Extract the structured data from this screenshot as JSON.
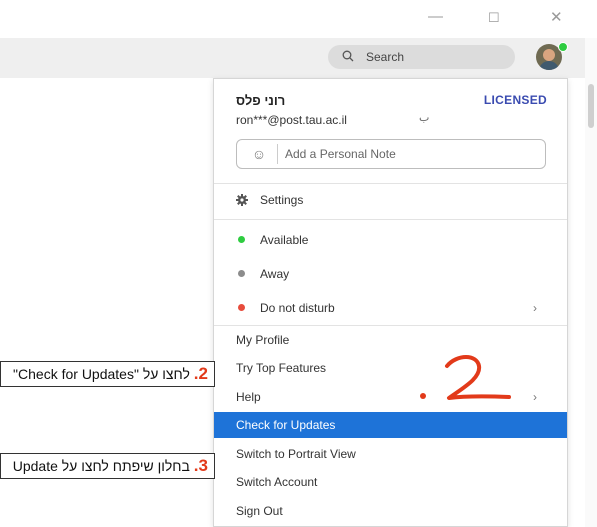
{
  "window": {
    "minimize": "—",
    "maximize": "☐",
    "close": "✕"
  },
  "search": {
    "label": "Search"
  },
  "profile": {
    "name": "רוני פלס",
    "license": "LICENSED",
    "email": "ron***@post.tau.ac.il",
    "mark": "ب",
    "note_placeholder": "Add a Personal Note"
  },
  "menu": {
    "settings": "Settings",
    "status": [
      {
        "label": "Available",
        "color": "#2ecc40"
      },
      {
        "label": "Away",
        "color": "#8c8c8c"
      },
      {
        "label": "Do not disturb",
        "color": "#e74c3c",
        "chevron": "›"
      }
    ],
    "items": [
      {
        "label": "My Profile"
      },
      {
        "label": "Try Top Features"
      },
      {
        "label": "Help",
        "chevron": "›"
      },
      {
        "label": "Check for Updates",
        "highlighted": true
      },
      {
        "label": "Switch to Portrait View"
      },
      {
        "label": "Switch Account"
      },
      {
        "label": "Sign Out"
      }
    ]
  },
  "instructions": [
    {
      "number": "2.",
      "text": "לחצו על \"Check for Updates\""
    },
    {
      "number": "3.",
      "text": "בחלון שיפתח לחצו על Update"
    }
  ],
  "colors": {
    "accent": "#1e73d8",
    "license": "#3a4bb0",
    "annotation": "#e23a1a"
  }
}
